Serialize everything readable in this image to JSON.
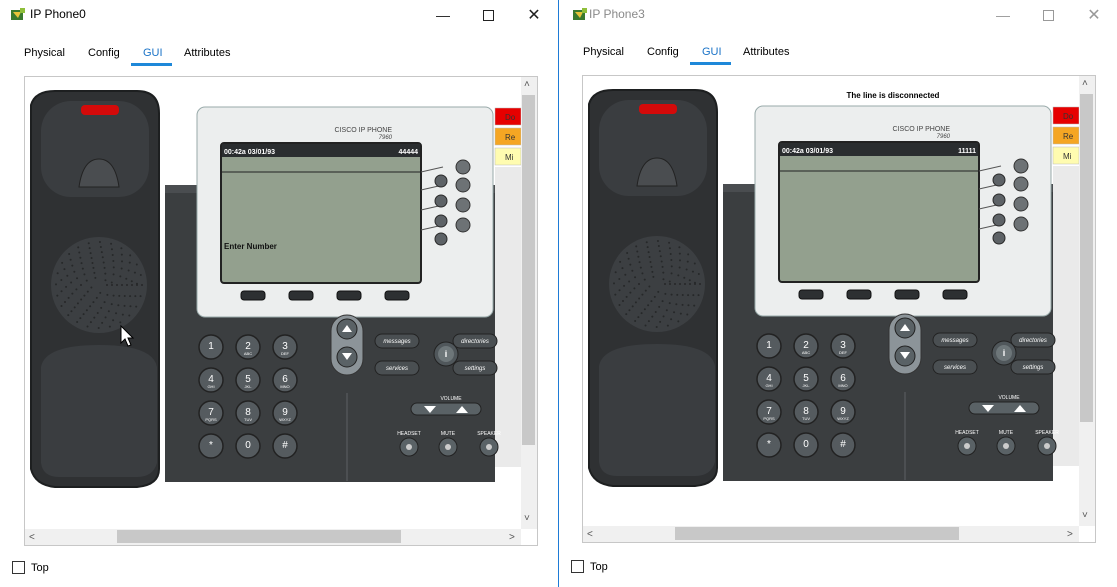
{
  "windows": [
    {
      "title": "IP Phone0",
      "tabs": [
        "Physical",
        "Config",
        "GUI",
        "Attributes"
      ],
      "active_tab": "GUI",
      "phone": {
        "brand": "CISCO IP PHONE",
        "model": "7960",
        "status_time": "00:42a 03/01/93",
        "status_number": "44444",
        "screen_message": "Enter Number",
        "top_message": "",
        "handset": "on-hook"
      },
      "side_tabs": [
        "Do",
        "Re",
        "Mi"
      ],
      "top_checkbox_label": "Top",
      "title_active": true
    },
    {
      "title": "IP Phone3",
      "tabs": [
        "Physical",
        "Config",
        "GUI",
        "Attributes"
      ],
      "active_tab": "GUI",
      "phone": {
        "brand": "CISCO IP PHONE",
        "model": "7960",
        "status_time": "00:42a 03/01/93",
        "status_number": "11111",
        "screen_message": "",
        "top_message": "The line is disconnected",
        "handset": "on-hook"
      },
      "side_tabs": [
        "Do",
        "Re",
        "Mi"
      ],
      "top_checkbox_label": "Top",
      "title_active": false
    }
  ],
  "keypad": [
    {
      "digit": "1",
      "letters": ""
    },
    {
      "digit": "2",
      "letters": "ABC"
    },
    {
      "digit": "3",
      "letters": "DEF"
    },
    {
      "digit": "4",
      "letters": "GHI"
    },
    {
      "digit": "5",
      "letters": "JKL"
    },
    {
      "digit": "6",
      "letters": "MNO"
    },
    {
      "digit": "7",
      "letters": "PQRS"
    },
    {
      "digit": "8",
      "letters": "TUV"
    },
    {
      "digit": "9",
      "letters": "WXYZ"
    },
    {
      "digit": "*",
      "letters": ""
    },
    {
      "digit": "0",
      "letters": ""
    },
    {
      "digit": "#",
      "letters": ""
    }
  ],
  "function_buttons": {
    "messages": "messages",
    "directories": "directories",
    "services": "services",
    "settings": "settings",
    "info": "i",
    "volume": "VOLUME",
    "headset": "HEADSET",
    "mute": "MUTE",
    "speaker": "SPEAKER"
  },
  "colors": {
    "phone_body": "#3b3e40",
    "handset": "#2f3133",
    "screen": "#93a08e",
    "faceplate": "#eceeee",
    "led": "#d40a0a",
    "accent_tab": "#1e88d9",
    "side_do": "#e60000",
    "side_re": "#f5a623",
    "side_mi": "#fffcb0"
  }
}
